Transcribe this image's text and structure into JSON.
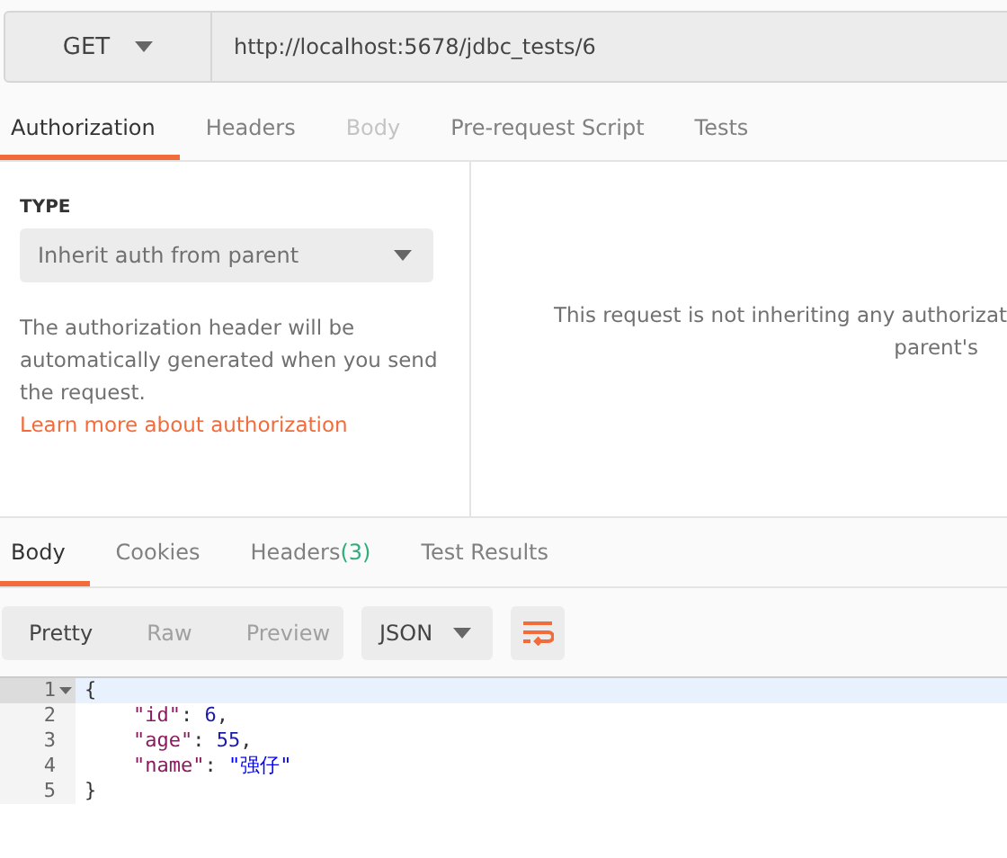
{
  "request": {
    "method": "GET",
    "url": "http://localhost:5678/jdbc_tests/6"
  },
  "request_tabs": [
    {
      "label": "Authorization",
      "selected": true,
      "disabled": false
    },
    {
      "label": "Headers",
      "selected": false,
      "disabled": false
    },
    {
      "label": "Body",
      "selected": false,
      "disabled": true
    },
    {
      "label": "Pre-request Script",
      "selected": false,
      "disabled": false
    },
    {
      "label": "Tests",
      "selected": false,
      "disabled": false
    }
  ],
  "auth": {
    "type_label": "TYPE",
    "type_value": "Inherit auth from parent",
    "description": "The authorization header will be automatically generated when you send the request.",
    "link": "Learn more about authorization",
    "message_lines": [
      "This request is not inheriting any authorizat",
      "parent's"
    ]
  },
  "response_tabs": [
    {
      "label": "Body",
      "selected": true
    },
    {
      "label": "Cookies",
      "selected": false
    },
    {
      "label": "Headers",
      "count": "(3)",
      "selected": false
    },
    {
      "label": "Test Results",
      "selected": false
    }
  ],
  "view_modes": [
    {
      "label": "Pretty",
      "selected": true
    },
    {
      "label": "Raw",
      "selected": false
    },
    {
      "label": "Preview",
      "selected": false
    }
  ],
  "format": "JSON",
  "code_lines": [
    {
      "number": "1",
      "selected": true,
      "foldable": true,
      "indent": false,
      "tokens": [
        {
          "kind": "punct",
          "text": "{"
        }
      ]
    },
    {
      "number": "2",
      "selected": false,
      "foldable": false,
      "indent": true,
      "tokens": [
        {
          "kind": "key",
          "text": "\"id\""
        },
        {
          "kind": "punct",
          "text": ": "
        },
        {
          "kind": "number",
          "text": "6"
        },
        {
          "kind": "punct",
          "text": ","
        }
      ]
    },
    {
      "number": "3",
      "selected": false,
      "foldable": false,
      "indent": true,
      "tokens": [
        {
          "kind": "key",
          "text": "\"age\""
        },
        {
          "kind": "punct",
          "text": ": "
        },
        {
          "kind": "number",
          "text": "55"
        },
        {
          "kind": "punct",
          "text": ","
        }
      ]
    },
    {
      "number": "4",
      "selected": false,
      "foldable": false,
      "indent": true,
      "tokens": [
        {
          "kind": "key",
          "text": "\"name\""
        },
        {
          "kind": "punct",
          "text": ": "
        },
        {
          "kind": "string",
          "text": "\"强仔\""
        }
      ]
    },
    {
      "number": "5",
      "selected": false,
      "foldable": false,
      "indent": false,
      "tokens": [
        {
          "kind": "punct",
          "text": "}"
        }
      ]
    }
  ]
}
